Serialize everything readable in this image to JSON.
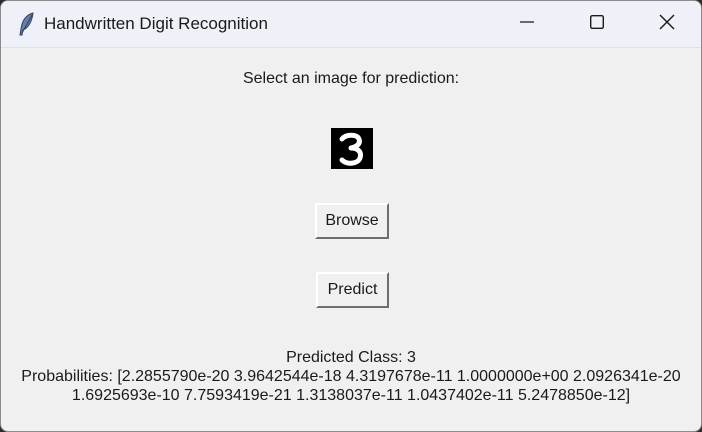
{
  "window": {
    "title": "Handwritten Digit Recognition",
    "controls": {
      "minimize": "minimize",
      "maximize": "maximize",
      "close": "close"
    }
  },
  "main": {
    "prompt": "Select an image for prediction:",
    "image": {
      "digit": "3",
      "background": "#000000",
      "foreground": "#ffffff"
    },
    "browse_label": "Browse",
    "predict_label": "Predict",
    "result": {
      "predicted_class": "Predicted Class: 3",
      "probabilities_line1": "Probabilities: [2.2855790e-20 3.9642544e-18 4.3197678e-11 1.0000000e+00 2.0926341e-20",
      "probabilities_line2": "1.6925693e-10 7.7593419e-21 1.3138037e-11 1.0437402e-11 5.2478850e-12]"
    }
  },
  "colors": {
    "titlebar": "#eef1f8",
    "window_bg": "#f0f0f0",
    "text": "#1a1a1a"
  },
  "icons": {
    "app": "feather-icon",
    "minimize": "minimize-icon",
    "maximize": "maximize-icon",
    "close": "close-icon"
  }
}
